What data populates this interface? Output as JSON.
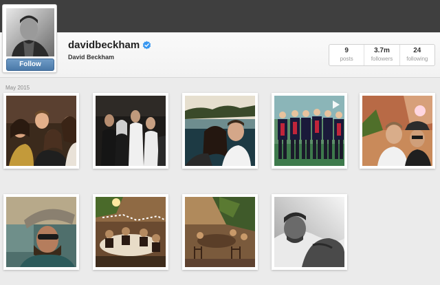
{
  "profile": {
    "username": "davidbeckham",
    "full_name": "David Beckham",
    "follow_label": "Follow",
    "verified": true
  },
  "stats": [
    {
      "value": "9",
      "label": "posts"
    },
    {
      "value": "3.7m",
      "label": "followers"
    },
    {
      "value": "24",
      "label": "following"
    }
  ],
  "section": {
    "month_label": "May 2015"
  },
  "photos": [
    {
      "name": "group-selfie-party",
      "video": false
    },
    {
      "name": "group-photo-dark-room",
      "video": false
    },
    {
      "name": "couple-selfie-lake",
      "video": false
    },
    {
      "name": "football-team-kit",
      "video": true
    },
    {
      "name": "selfie-with-hat",
      "video": false
    },
    {
      "name": "selfie-hat-sunglasses",
      "video": false
    },
    {
      "name": "dinner-table-party",
      "video": false
    },
    {
      "name": "garden-terrace-dinner",
      "video": false
    },
    {
      "name": "black-white-selfie-pillow",
      "video": false
    }
  ],
  "colors": {
    "topbar": "#3f3f3f",
    "follow_button": "#4a79a8",
    "verified_badge": "#3897f0"
  }
}
